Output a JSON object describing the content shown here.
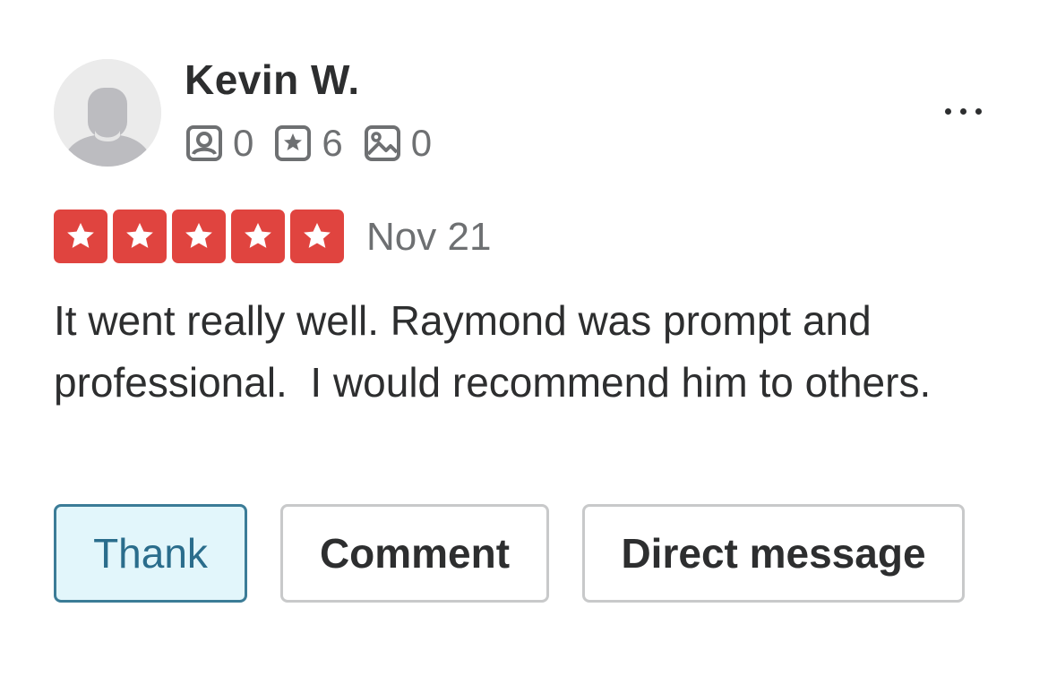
{
  "review": {
    "user": {
      "name": "Kevin W.",
      "avatar_icon": "default-avatar-icon",
      "stats": {
        "friends": "0",
        "reviews": "6",
        "photos": "0"
      }
    },
    "rating": 5,
    "rating_max": 5,
    "date": "Nov 21",
    "text": "It went really well. Raymond was prompt and professional.  I would recommend him to others."
  },
  "actions": {
    "thank_label": "Thank",
    "comment_label": "Comment",
    "direct_message_label": "Direct message"
  },
  "colors": {
    "star_red": "#e0443f",
    "thank_bg": "#e2f6fb",
    "thank_border": "#3b7c97",
    "text_primary": "#2d2e2f",
    "text_secondary": "#6e7072"
  }
}
